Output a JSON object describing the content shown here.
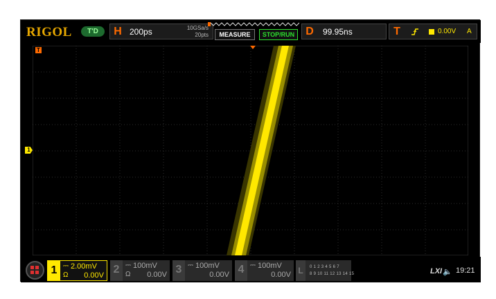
{
  "brand": "RIGOL",
  "mode_badge": "T'D",
  "horizontal": {
    "letter": "H",
    "timebase": "200ps",
    "sample_rate": "10GSa/s",
    "memory_depth": "20pts"
  },
  "buttons": {
    "measure": "MEASURE",
    "stop_run": "STOP/RUN"
  },
  "delay": {
    "letter": "D",
    "value": "99.95ns"
  },
  "trigger": {
    "letter": "T",
    "slope_icon": "rising-edge-icon",
    "source_icon": "channel-square-icon",
    "level": "0.00V",
    "source": "A"
  },
  "channels": [
    {
      "number": "1",
      "coupling": "⎓",
      "scale": "2.00mV",
      "impedance": "Ω",
      "offset": "0.00V",
      "active": true
    },
    {
      "number": "2",
      "coupling": "⎓",
      "scale": "100mV",
      "impedance": "Ω",
      "offset": "0.00V",
      "active": false
    },
    {
      "number": "3",
      "coupling": "⎓",
      "scale": "100mV",
      "impedance": "",
      "offset": "0.00V",
      "active": false
    },
    {
      "number": "4",
      "coupling": "⎓",
      "scale": "100mV",
      "impedance": "",
      "offset": "0.00V",
      "active": false
    }
  ],
  "logic": {
    "letter": "L",
    "row1": "0 1 2 3  4 5 6 7",
    "row2": "8 9 10 11  12 13 14 15"
  },
  "status": {
    "lxi": "LXI",
    "speaker": "🔈",
    "time": "19:21"
  },
  "markers": {
    "trigger_pos": "T",
    "channel1": "1"
  },
  "colors": {
    "brand": "#e8a800",
    "channel1": "#ffe800",
    "accent_orange": "#ff6a00",
    "run_green": "#2ee02e"
  }
}
